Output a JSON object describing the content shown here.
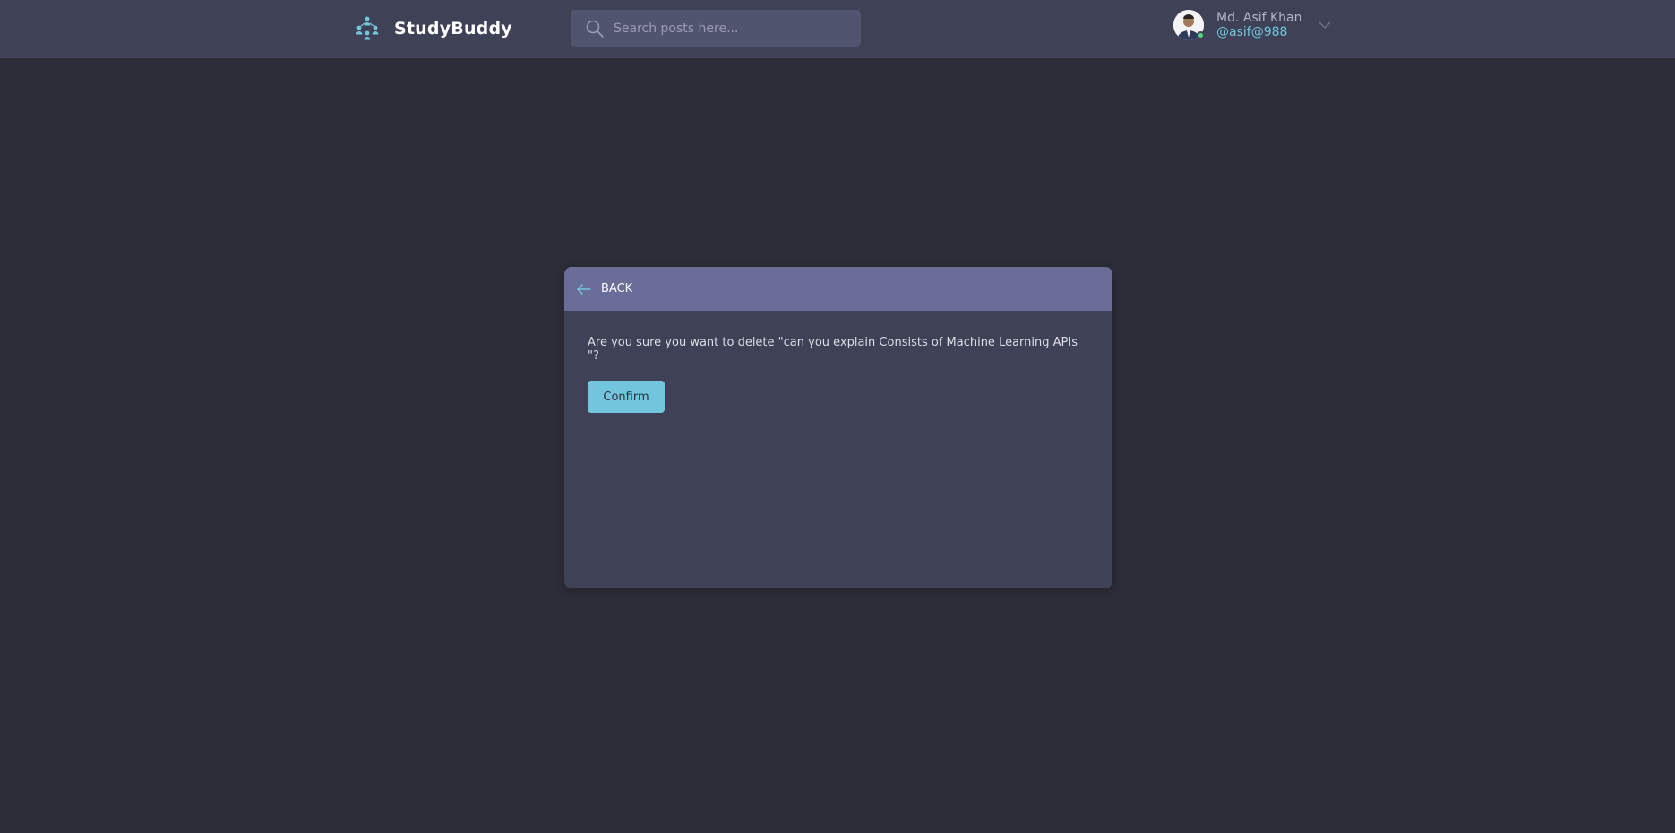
{
  "header": {
    "brand": "StudyBuddy",
    "logo_icon": "study-group-icon",
    "search": {
      "placeholder": "Search posts here...",
      "value": "",
      "icon": "search-icon"
    },
    "user": {
      "name": "Md. Asif Khan",
      "handle": "@asif@988",
      "status": "online",
      "status_color": "#4fd67a"
    }
  },
  "dialog": {
    "back_label": "BACK",
    "message": "Are you sure you want to delete \"can you explain Consists of Machine Learning APIs \"?",
    "confirm_label": "Confirm"
  },
  "colors": {
    "background": "#2d2d39",
    "header": "#3f4156",
    "card": "#3f4156",
    "card_header": "#696d97",
    "accent": "#71c6dd"
  }
}
